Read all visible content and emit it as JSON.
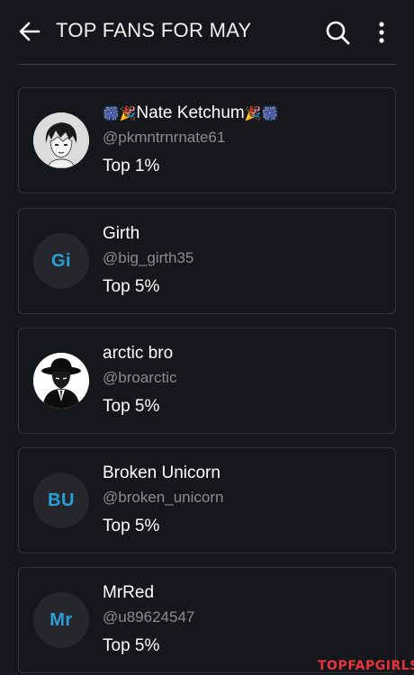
{
  "header": {
    "title": "TOP FANS FOR MAY",
    "back_icon": "back-arrow-icon",
    "search_icon": "search-icon",
    "more_icon": "more-vertical-icon"
  },
  "fans": [
    {
      "name_prefix": "🎆🎉",
      "name": "Nate Ketchum",
      "name_suffix": "🎉🎆",
      "handle": "@pkmntrnrnate61",
      "rank": "Top 1%",
      "avatar_type": "image",
      "initials": ""
    },
    {
      "name_prefix": "",
      "name": "Girth",
      "name_suffix": "",
      "handle": "@big_girth35",
      "rank": "Top 5%",
      "avatar_type": "initials",
      "initials": "Gi"
    },
    {
      "name_prefix": "",
      "name": "arctic bro",
      "name_suffix": "",
      "handle": "@broarctic",
      "rank": "Top 5%",
      "avatar_type": "image",
      "initials": ""
    },
    {
      "name_prefix": "",
      "name": "Broken Unicorn",
      "name_suffix": "",
      "handle": "@broken_unicorn",
      "rank": "Top 5%",
      "avatar_type": "initials",
      "initials": "BU"
    },
    {
      "name_prefix": "",
      "name": "MrRed",
      "name_suffix": "",
      "handle": "@u89624547",
      "rank": "Top 5%",
      "avatar_type": "initials",
      "initials": "Mr"
    }
  ],
  "watermark": "TOPFAPGIRLS",
  "colors": {
    "background": "#16171b",
    "card_border": "#34363c",
    "initials": "#2a9fd8",
    "handle": "#8a8d94",
    "watermark": "#e8343f"
  }
}
